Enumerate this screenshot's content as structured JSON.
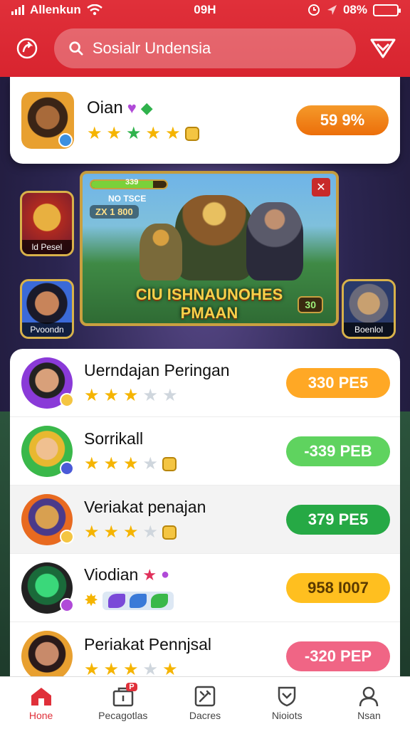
{
  "status_bar": {
    "carrier": "Allenkun",
    "time": "09H",
    "battery": "08%"
  },
  "search": {
    "placeholder": "Sosialr Undensia"
  },
  "featured": {
    "name": "Oian",
    "badge": "59 9%"
  },
  "banner": {
    "hp_value": "339",
    "sub1": "NO TSCE",
    "sub2": "ZX 1 800",
    "title_line1": "CIU ISHNAUNOHES",
    "title_line2": "PMAAN",
    "score": "30"
  },
  "side_cards": {
    "left_top": "ld Pesel",
    "left_bottom": "Pvoondn",
    "right_bottom": "Boenlol"
  },
  "list": [
    {
      "name": "Uerndajan Peringan",
      "badge": "330 PE5",
      "badge_color": "#ffa825"
    },
    {
      "name": "Sorrikall",
      "badge": "-339 PEB",
      "badge_color": "#5fd35f"
    },
    {
      "name": "Veriakat penajan",
      "badge": "379 PE5",
      "badge_color": "#26a945"
    },
    {
      "name": "Viodian",
      "badge": "958 I007",
      "badge_color": "#ffbf1f"
    },
    {
      "name": "Periakat Pennjsal",
      "badge": "-320 PEP",
      "badge_color": "#f06585"
    }
  ],
  "nav": [
    {
      "label": "Hone",
      "icon": "home-icon",
      "active": true
    },
    {
      "label": "Pecagotlas",
      "icon": "shop-icon",
      "badge": "P"
    },
    {
      "label": "Dacres",
      "icon": "tools-icon"
    },
    {
      "label": "Nioiots",
      "icon": "shield-icon"
    },
    {
      "label": "Nsan",
      "icon": "user-icon"
    }
  ],
  "colors": {
    "header": "#e0303a",
    "featured_badge": "#f07d12"
  }
}
